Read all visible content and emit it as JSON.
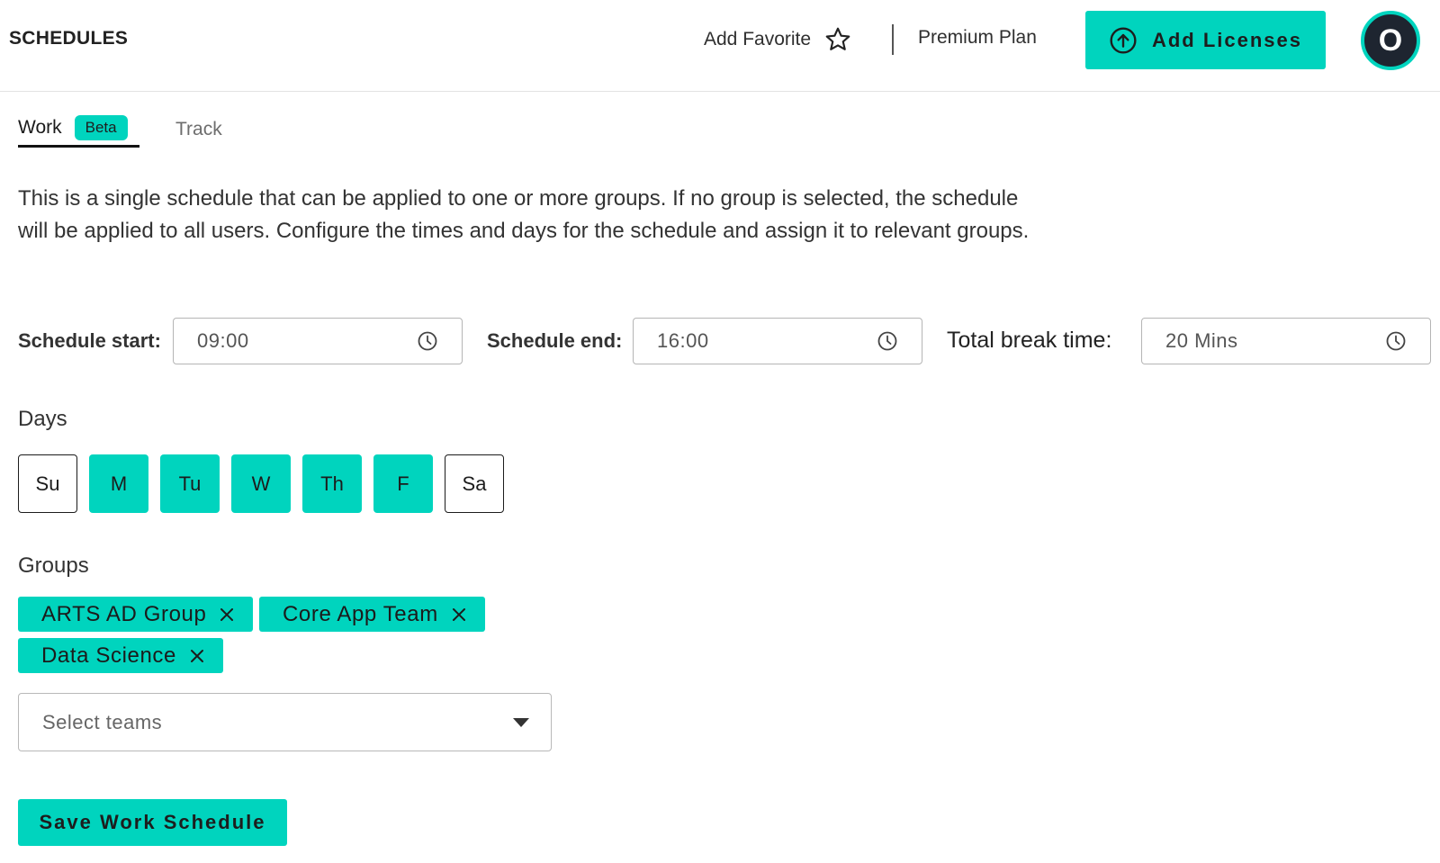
{
  "header": {
    "title": "SCHEDULES",
    "favorite_label": "Add Favorite",
    "plan_label": "Premium Plan",
    "add_licenses_label": "Add Licenses",
    "avatar_initial": "O"
  },
  "tabs": {
    "work_label": "Work",
    "work_badge": "Beta",
    "track_label": "Track"
  },
  "description": "This is a single schedule that can be applied to one or more groups. If no group is selected, the schedule will be applied to all users. Configure the times and days for the schedule and assign it to relevant groups.",
  "schedule": {
    "start_label": "Schedule start:",
    "start_value": "09:00",
    "end_label": "Schedule end:",
    "end_value": "16:00",
    "break_label": "Total break time:",
    "break_value": "20 Mins"
  },
  "days": {
    "label": "Days",
    "items": [
      {
        "label": "Su",
        "selected": false
      },
      {
        "label": "M",
        "selected": true
      },
      {
        "label": "Tu",
        "selected": true
      },
      {
        "label": "W",
        "selected": true
      },
      {
        "label": "Th",
        "selected": true
      },
      {
        "label": "F",
        "selected": true
      },
      {
        "label": "Sa",
        "selected": false
      }
    ]
  },
  "groups": {
    "label": "Groups",
    "chips": [
      "ARTS AD Group",
      "Core App Team",
      "Data Science"
    ],
    "select_placeholder": "Select teams"
  },
  "actions": {
    "save_label": "Save Work Schedule"
  },
  "colors": {
    "accent": "#00d4be",
    "avatar_bg": "#1e2530"
  }
}
